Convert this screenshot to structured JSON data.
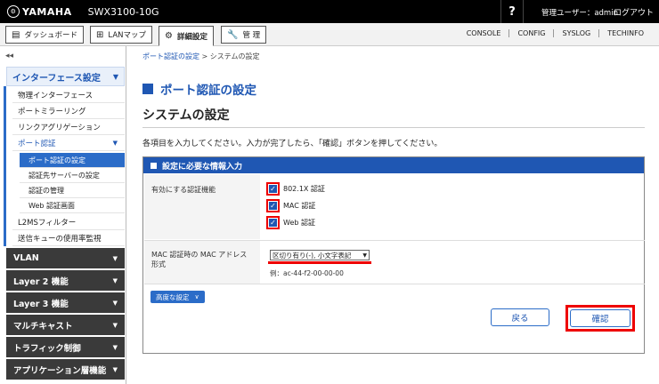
{
  "header": {
    "brand": "YAMAHA",
    "model": "SWX3100-10G",
    "help_label": "?",
    "user_label": "管理ユーザー：admin",
    "logout_label": "ログアウト"
  },
  "nav": {
    "dashboard": "ダッシュボード",
    "lanmap": "LANマップ",
    "advanced": "詳細設定",
    "admin": "管 理",
    "links": [
      "CONSOLE",
      "CONFIG",
      "SYSLOG",
      "TECHINFO"
    ]
  },
  "sidebar": {
    "collapse_icon": "◂◂",
    "group_title": "インターフェース設定",
    "items": [
      "物理インターフェース",
      "ポートミラーリング",
      "リンクアグリゲーション",
      "ポート認証"
    ],
    "subitems": [
      "ポート認証の設定",
      "認証先サーバーの設定",
      "認証の管理",
      "Web 認証画面"
    ],
    "after_items": [
      "L2MSフィルター",
      "送信キューの使用率監視"
    ],
    "sections": [
      "VLAN",
      "Layer 2 機能",
      "Layer 3 機能",
      "マルチキャスト",
      "トラフィック制御",
      "アプリケーション層機能"
    ]
  },
  "main": {
    "breadcrumb_link": "ポート認証の設定",
    "breadcrumb_sep": " > ",
    "breadcrumb_current": "システムの設定",
    "page_title": "ポート認証の設定",
    "subtitle": "システムの設定",
    "instruction": "各項目を入力してください。入力が完了したら、「確認」ボタンを押してください。",
    "panel_title": "設定に必要な情報入力",
    "auth_label": "有効にする認証機能",
    "auth_options": [
      "802.1X 認証",
      "MAC 認証",
      "Web 認証"
    ],
    "mac_format_label_1": "MAC 認証時の MAC アドレス",
    "mac_format_label_2": "形式",
    "mac_format_selected": "区切り有り(-), 小文字表記",
    "mac_format_example": "例：ac-44-f2-00-00-00",
    "advanced_label": "高度な設定",
    "back_label": "戻る",
    "confirm_label": "確認"
  }
}
